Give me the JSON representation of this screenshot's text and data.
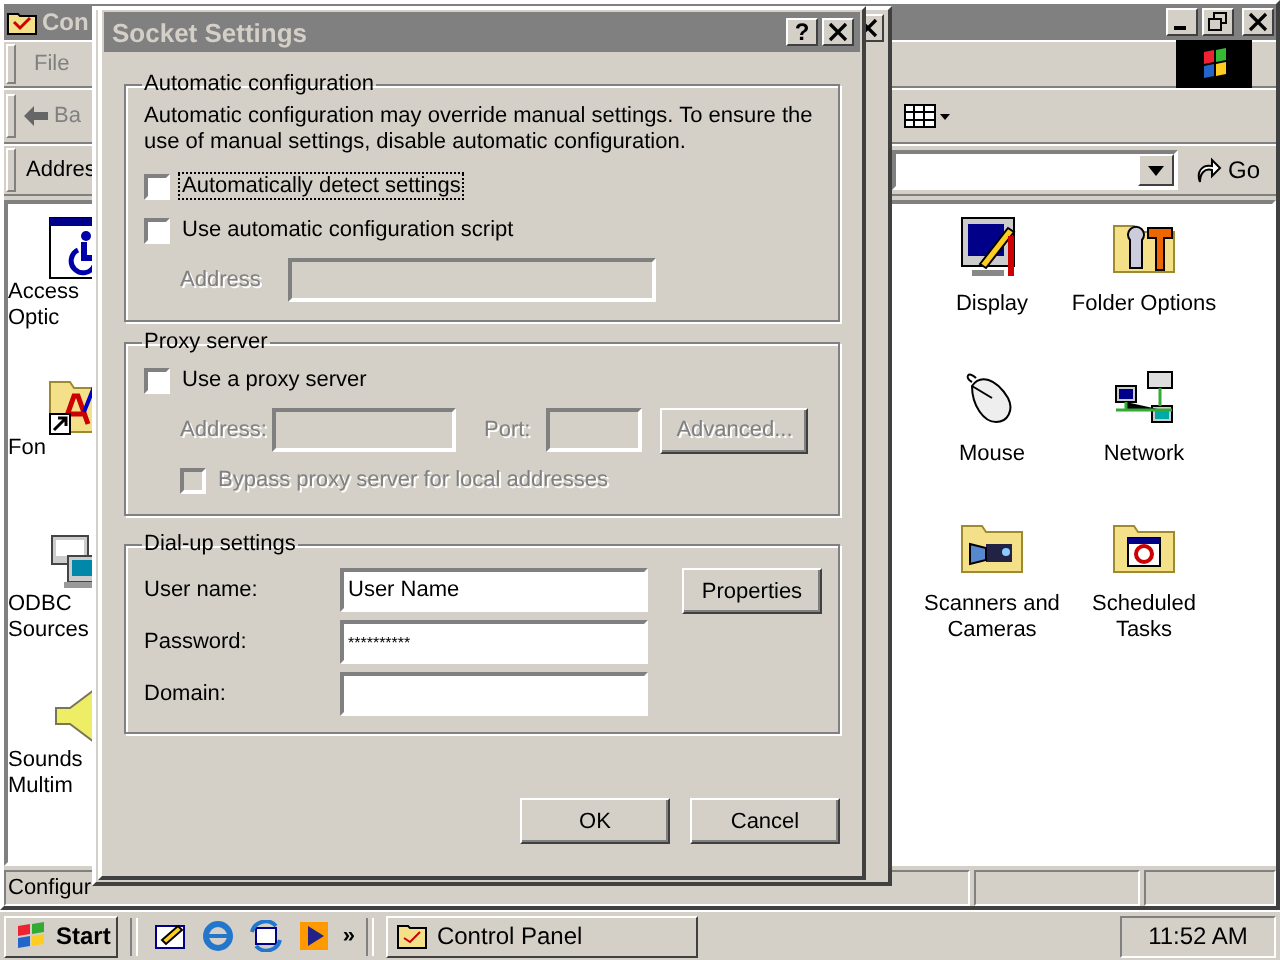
{
  "control_panel": {
    "title": "Con",
    "menu": [
      "File"
    ],
    "back": "Ba",
    "address_label": "Addres",
    "go": "Go",
    "left_icons": [
      {
        "kind": "accessibility",
        "lines": [
          "Access",
          "Optic"
        ]
      },
      {
        "kind": "fonts",
        "lines": [
          "Fon"
        ]
      },
      {
        "kind": "odbc",
        "lines": [
          "ODBC",
          "Sources"
        ]
      },
      {
        "kind": "sound",
        "lines": [
          "Sounds",
          "Multim"
        ]
      }
    ],
    "icons": [
      {
        "kind": "display",
        "label": "Display"
      },
      {
        "kind": "folder_options",
        "label": "Folder Options"
      },
      {
        "kind": "mouse",
        "label": "Mouse"
      },
      {
        "kind": "network",
        "label": "Network"
      },
      {
        "kind": "scanners",
        "label": "Scanners and Cameras"
      },
      {
        "kind": "tasks",
        "label": "Scheduled Tasks"
      }
    ],
    "status": "Configur"
  },
  "socket_settings": {
    "title": "Socket Settings",
    "help": "?",
    "auto": {
      "legend": "Automatic configuration",
      "note": "Automatic configuration may override manual settings.  To ensure the use of manual settings, disable automatic configuration.",
      "options": [
        {
          "label": "Automatically detect settings",
          "checked": false,
          "focused": true
        },
        {
          "label": "Use automatic configuration script",
          "checked": false,
          "focused": false
        }
      ],
      "address": {
        "label": "Address",
        "disabled": true
      }
    },
    "proxy": {
      "legend": "Proxy server",
      "use": {
        "label": "Use a proxy server",
        "checked": false
      },
      "address": {
        "label": "Address:",
        "disabled": true
      },
      "port": {
        "label": "Port:",
        "disabled": true
      },
      "advanced": {
        "label": "Advanced...",
        "disabled": true
      },
      "bypass": {
        "label": "Bypass proxy server for local addresses",
        "checked": false,
        "disabled": true
      }
    },
    "dialup": {
      "legend": "Dial-up settings",
      "fields": [
        {
          "label": "User name:",
          "value": "User Name"
        },
        {
          "label": "Password:",
          "value": "**********"
        },
        {
          "label": "Domain:"
        }
      ],
      "properties": "Properties"
    },
    "buttons": [
      "OK",
      "Cancel"
    ]
  },
  "taskbar": {
    "start": "Start",
    "more": "»",
    "tasks": [
      {
        "label": "Control Panel",
        "selected": false
      }
    ],
    "clock": "11:52 AM"
  }
}
